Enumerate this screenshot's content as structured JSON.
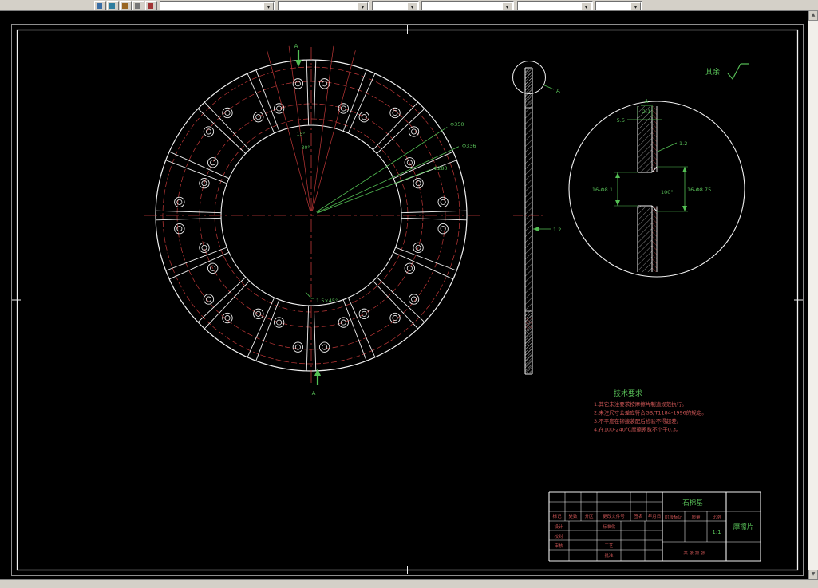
{
  "colors": {
    "background": "#000000",
    "line_white": "#f0f0f0",
    "line_red": "#c03838",
    "line_green": "#54c054",
    "toolbar_gray": "#d4d0c8"
  },
  "front_view": {
    "diameter_labels": [
      "Φ350",
      "Φ336",
      "Φ280"
    ],
    "angle_labels": [
      "15°",
      "30°"
    ],
    "chamfer_label": "1.5×45°",
    "section_letter_top": "A",
    "section_letter_bottom": "A"
  },
  "side_view": {
    "thickness_label": "1.2",
    "detail_letter": "A"
  },
  "detail_view": {
    "letter": "A",
    "scale": "2:1",
    "plate_thickness": "5.5",
    "facing_thickness": "1.2",
    "hole_dim": "16-Φ8.1",
    "countersink_angle": "100°",
    "countersink_dim": "16-Φ8.75"
  },
  "surface_note": {
    "label": "其余"
  },
  "tech_requirements": {
    "title": "技术要求",
    "items": [
      "1.其它未注要求按摩擦片制造规范执行。",
      "2.未注尺寸公差应符合GB/T1184-1996的规定。",
      "3.不平度在铆接装配后检验不得超差。",
      "4.在100-240℃摩擦系数不小于0.3。"
    ]
  },
  "title_block": {
    "material": "石棉基",
    "part_name": "摩擦片",
    "scale_value": "1:1",
    "sheet_note": "共 张 第 张",
    "labels": {
      "mark": "标记",
      "count": "处数",
      "zone": "分区",
      "change_doc": "更改文件号",
      "sign": "签名",
      "date": "年月日",
      "design": "设计",
      "standard": "标准化",
      "check": "校对",
      "audit": "审核",
      "process": "工艺",
      "approve": "批准",
      "stage": "阶段标记",
      "mass": "质量",
      "scale": "比例"
    }
  }
}
